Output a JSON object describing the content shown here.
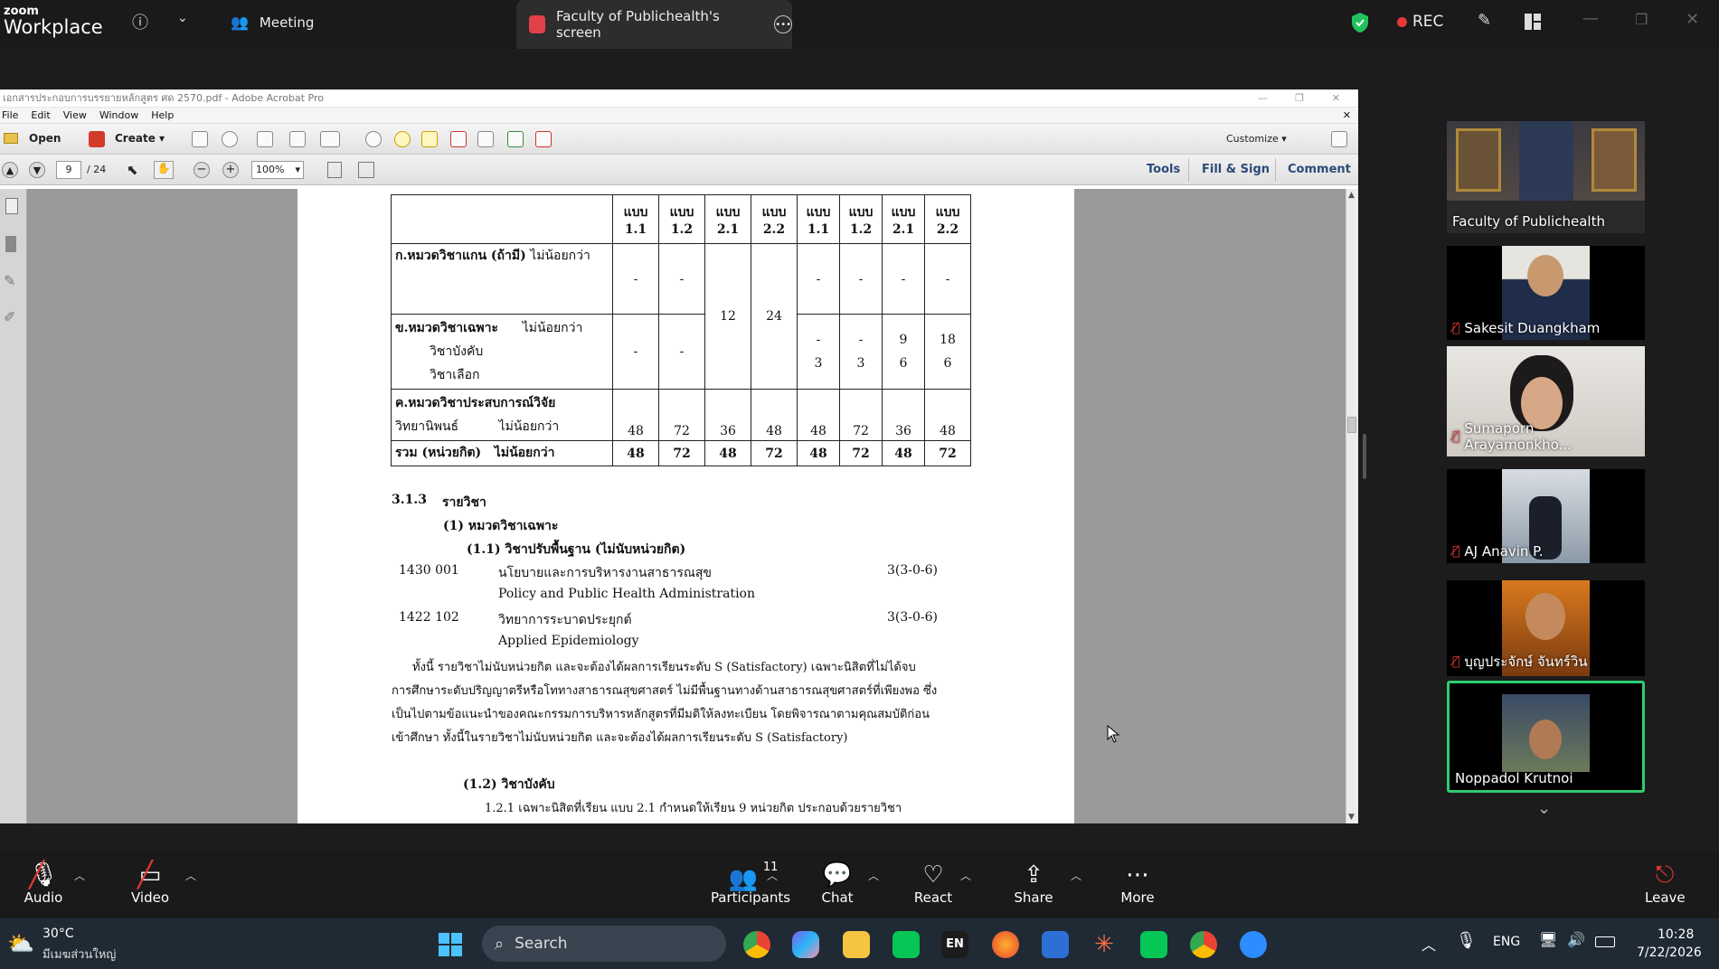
{
  "zoom": {
    "brand_top": "zoom",
    "brand_bottom": "Workplace",
    "meeting_label": "Meeting",
    "share_tab_label": "Faculty of Publichealth's screen",
    "rec_label": "REC"
  },
  "acrobat": {
    "title": "เอกสารประกอบการบรรยายหลักสูตร ศด 2570.pdf - Adobe Acrobat Pro",
    "menu": [
      "File",
      "Edit",
      "View",
      "Window",
      "Help"
    ],
    "toolbar": {
      "open": "Open",
      "create": "Create",
      "customize": "Customize"
    },
    "nav": {
      "page": "9",
      "total": "/ 24",
      "zoom": "100%"
    },
    "right_tabs": {
      "tools": "Tools",
      "fill_sign": "Fill & Sign",
      "comment": "Comment"
    }
  },
  "document": {
    "table": {
      "header": [
        "แบบ 1.1",
        "แบบ 1.2",
        "แบบ 2.1",
        "แบบ 2.2",
        "แบบ 1.1",
        "แบบ 1.2",
        "แบบ 2.1",
        "แบบ 2.2"
      ],
      "header_top": [
        "แบบ",
        "แบบ",
        "แบบ",
        "แบบ",
        "แบบ",
        "แบบ",
        "แบบ",
        "แบบ"
      ],
      "header_bottom": [
        "1.1",
        "1.2",
        "2.1",
        "2.2",
        "1.1",
        "1.2",
        "2.1",
        "2.2"
      ],
      "row_a_label_bold": "ก.หมวดวิชาแกน (ถ้ามี)",
      "row_a_label_rest": "ไม่น้อยกว่า",
      "row_a": [
        "-",
        "-",
        "-",
        "-",
        "-",
        "-"
      ],
      "merged_21": "12",
      "merged_22": "24",
      "row_b_label_bold": "ข.หมวดวิชาเฉพาะ",
      "row_b_label_rest": "ไม่น้อยกว่า",
      "row_b_sub1": "วิชาบังคับ",
      "row_b_sub2": "วิชาเลือก",
      "row_b_c1": "-",
      "row_b_c2": "-",
      "row_b_c5": [
        "-",
        "3"
      ],
      "row_b_c6": [
        "-",
        "3"
      ],
      "row_b_c7": [
        "9",
        "6"
      ],
      "row_b_c8": [
        "18",
        "6"
      ],
      "row_c_label_bold": "ค.หมวดวิชาประสบการณ์วิจัย",
      "row_c_sub": "วิทยานิพนธ์",
      "row_c_rest": "ไม่น้อยกว่า",
      "row_c": [
        "48",
        "72",
        "36",
        "48",
        "48",
        "72",
        "36",
        "48"
      ],
      "total_label_bold": "รวม (หน่วยกิต)",
      "total_label_rest": "ไม่น้อยกว่า",
      "total": [
        "48",
        "72",
        "48",
        "72",
        "48",
        "72",
        "48",
        "72"
      ]
    },
    "section_num": "3.1.3",
    "section_title": "รายวิชา",
    "sub1": "(1) หมวดวิชาเฉพาะ",
    "sub11": "(1.1) วิชาปรับพื้นฐาน (ไม่นับหน่วยกิต)",
    "course1_code": "1430 001",
    "course1_th": "นโยบายและการบริหารงานสาธารณสุข",
    "course1_credit": "3(3-0-6)",
    "course1_en": "Policy and Public Health Administration",
    "course2_code": "1422 102",
    "course2_th": "วิทยาการระบาดประยุกต์",
    "course2_credit": "3(3-0-6)",
    "course2_en": "Applied Epidemiology",
    "para1": "ทั้งนี้ รายวิชาไม่นับหน่วยกิต และจะต้องได้ผลการเรียนระดับ S (Satisfactory) เฉพาะนิสิตที่ไม่ได้จบ",
    "para2": "การศึกษาระดับปริญญาตรีหรือโททางสาธารณสุขศาสตร์ ไม่มีพื้นฐานทางด้านสาธารณสุขศาสตร์ที่เพียงพอ ซึ่ง",
    "para3": "เป็นไปตามข้อแนะนำของคณะกรรมการบริหารหลักสูตรที่มีมติให้ลงทะเบียน โดยพิจารณาตามคุณสมบัติก่อน",
    "para4": "เข้าศึกษา ทั้งนี้ในรายวิชาไม่นับหน่วยกิต และจะต้องได้ผลการเรียนระดับ S (Satisfactory)",
    "sub12": "(1.2) วิชาบังคับ",
    "sub121": "1.2.1 เฉพาะนิสิตที่เรียน แบบ 2.1 กำหนดให้เรียน 9 หน่วยกิต ประกอบด้วยรายวิชา"
  },
  "participants_panel": [
    {
      "name": "Faculty of Publichealth",
      "muted": false
    },
    {
      "name": "Sakesit Duangkham",
      "muted": true
    },
    {
      "name": "Sumaporn Arayamonkho...",
      "muted": true
    },
    {
      "name": "AJ Anavin P.",
      "muted": true
    },
    {
      "name": "บุญประจักษ์ จันทร์วิน",
      "muted": true
    },
    {
      "name": "Noppadol Krutnoi",
      "muted": false
    }
  ],
  "controls": {
    "audio": "Audio",
    "video": "Video",
    "participants": "Participants",
    "participant_count": "11",
    "chat": "Chat",
    "react": "React",
    "share": "Share",
    "more": "More",
    "leave": "Leave"
  },
  "taskbar": {
    "weather_temp": "30°C",
    "weather_desc": "มีเมฆส่วนใหญ่",
    "search": "Search",
    "lang": "ENG",
    "time": "10:28",
    "date": "7/22/2026"
  },
  "colors": {
    "active_speaker": "#2ecc71",
    "rec_dot": "#e53935",
    "shield": "#21c25e"
  }
}
